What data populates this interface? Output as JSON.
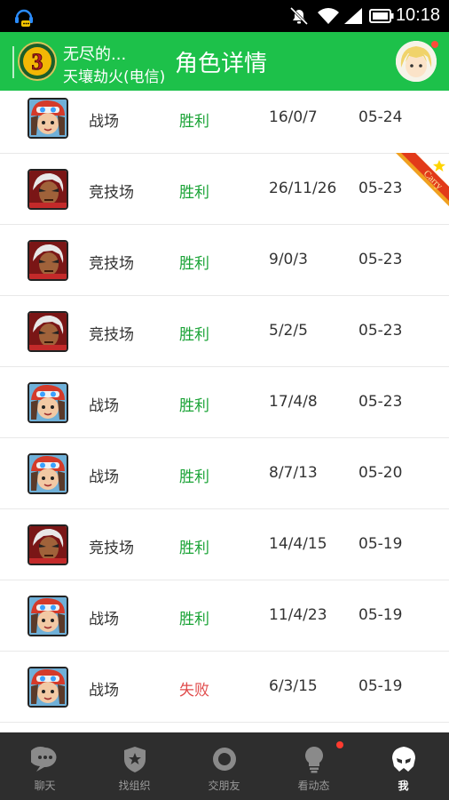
{
  "status_bar": {
    "time": "10:18"
  },
  "header": {
    "character_name": "无尽的...",
    "server": "天壤劫火(电信)",
    "title": "角色详情",
    "badge_level": "3"
  },
  "matches": [
    {
      "hero": "hero-b",
      "mode": "战场",
      "result": "胜利",
      "result_color": "#1aa336",
      "kda": "16/0/7",
      "date": "05-24",
      "carry": false
    },
    {
      "hero": "hero-a",
      "mode": "竞技场",
      "result": "胜利",
      "result_color": "#1aa336",
      "kda": "26/11/26",
      "date": "05-23",
      "carry": true
    },
    {
      "hero": "hero-a",
      "mode": "竞技场",
      "result": "胜利",
      "result_color": "#1aa336",
      "kda": "9/0/3",
      "date": "05-23",
      "carry": false
    },
    {
      "hero": "hero-a",
      "mode": "竞技场",
      "result": "胜利",
      "result_color": "#1aa336",
      "kda": "5/2/5",
      "date": "05-23",
      "carry": false
    },
    {
      "hero": "hero-b",
      "mode": "战场",
      "result": "胜利",
      "result_color": "#1aa336",
      "kda": "17/4/8",
      "date": "05-23",
      "carry": false
    },
    {
      "hero": "hero-b",
      "mode": "战场",
      "result": "胜利",
      "result_color": "#1aa336",
      "kda": "8/7/13",
      "date": "05-20",
      "carry": false
    },
    {
      "hero": "hero-a",
      "mode": "竞技场",
      "result": "胜利",
      "result_color": "#1aa336",
      "kda": "14/4/15",
      "date": "05-19",
      "carry": false
    },
    {
      "hero": "hero-b",
      "mode": "战场",
      "result": "胜利",
      "result_color": "#1aa336",
      "kda": "11/4/23",
      "date": "05-19",
      "carry": false
    },
    {
      "hero": "hero-b",
      "mode": "战场",
      "result": "失败",
      "result_color": "#e04b4b",
      "kda": "6/3/15",
      "date": "05-19",
      "carry": false
    }
  ],
  "carry_label": "Carry",
  "tabs": [
    {
      "label": "聊天",
      "icon": "chat-bubble-icon",
      "active": false
    },
    {
      "label": "找组织",
      "icon": "shield-star-icon",
      "active": false
    },
    {
      "label": "交朋友",
      "icon": "ring-icon",
      "active": false
    },
    {
      "label": "看动态",
      "icon": "lightbulb-icon",
      "active": false,
      "badge_dot": true
    },
    {
      "label": "我",
      "icon": "helmet-icon",
      "active": true
    }
  ],
  "colors": {
    "header_green": "#1dc14a",
    "tabbar": "#2e2e2e",
    "win": "#1aa336",
    "loss": "#e04b4b"
  }
}
